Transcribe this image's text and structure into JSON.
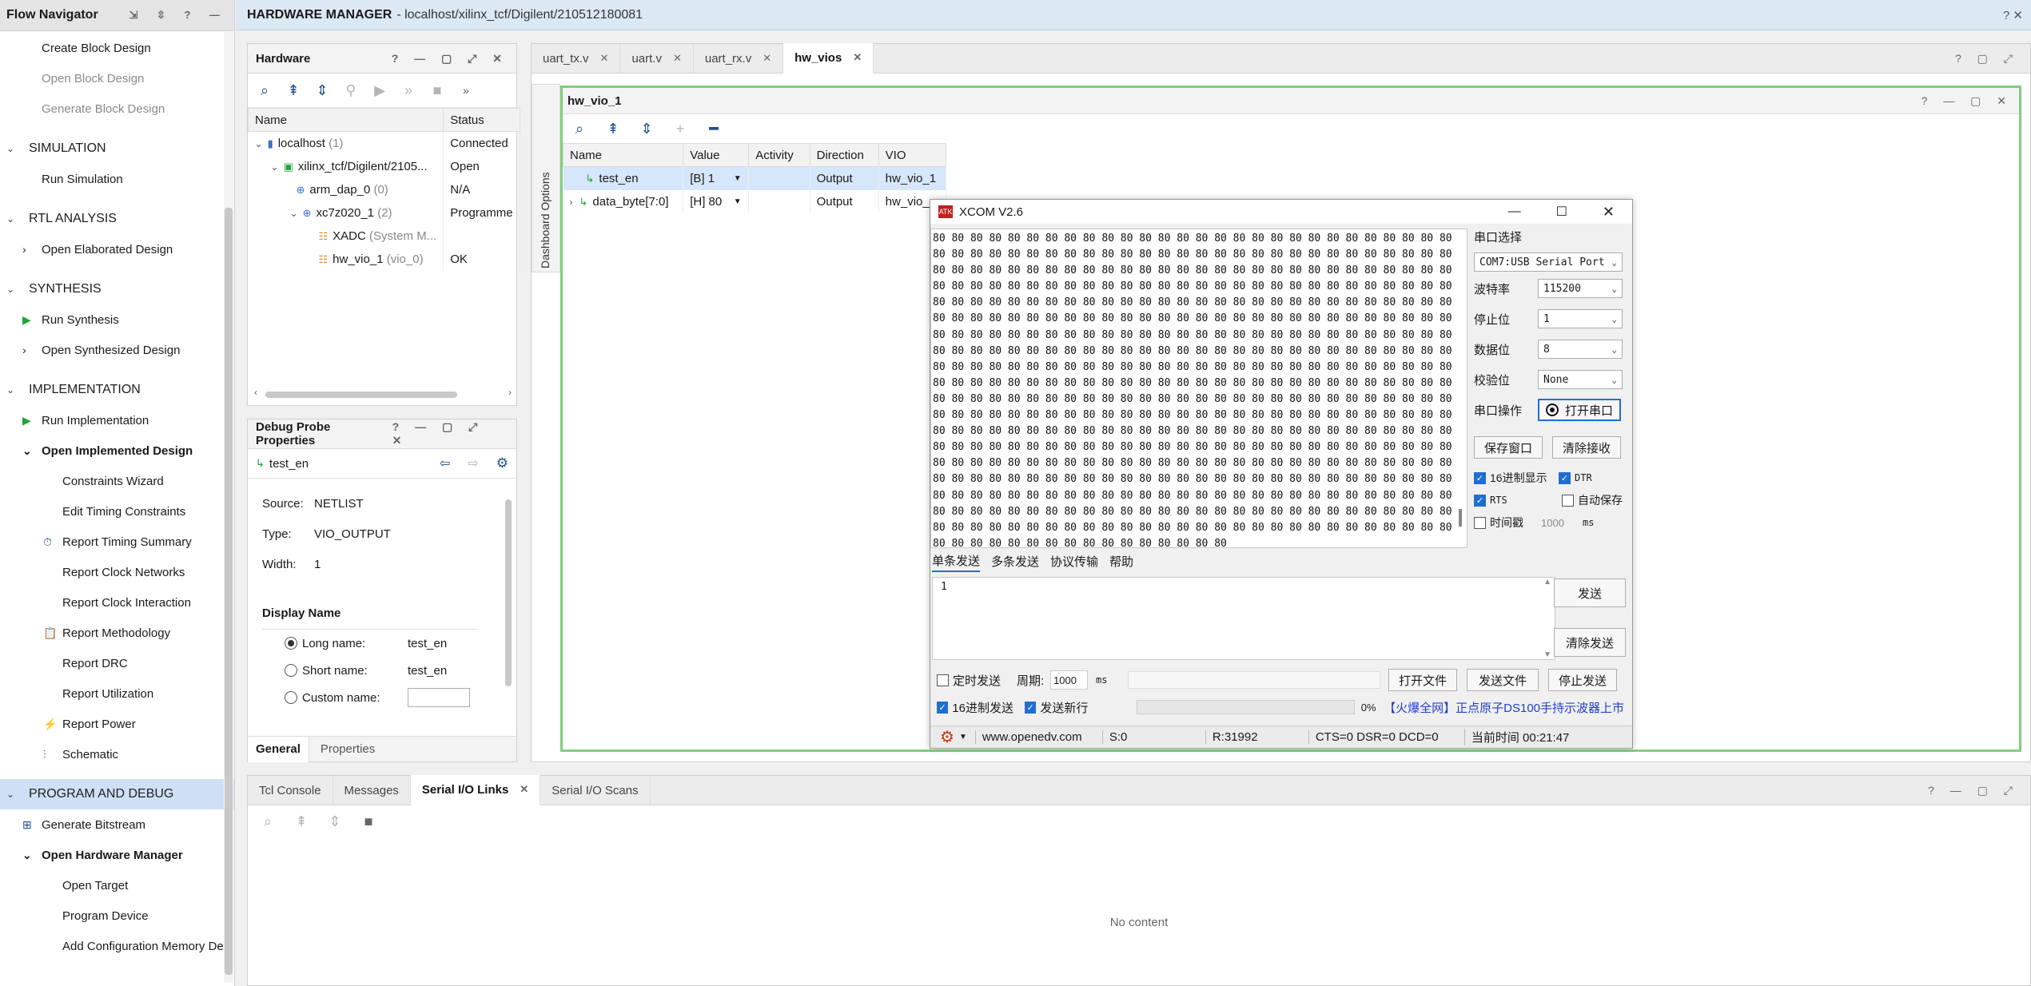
{
  "flow_navigator": {
    "title": "Flow Navigator",
    "items": [
      {
        "kind": "item",
        "label": "Create Block Design",
        "state": "normal"
      },
      {
        "kind": "item",
        "label": "Open Block Design",
        "state": "disabled"
      },
      {
        "kind": "item",
        "label": "Generate Block Design",
        "state": "disabled"
      },
      {
        "kind": "section",
        "label": "SIMULATION"
      },
      {
        "kind": "item",
        "label": "Run Simulation",
        "state": "normal"
      },
      {
        "kind": "section",
        "label": "RTL ANALYSIS"
      },
      {
        "kind": "item",
        "label": "Open Elaborated Design",
        "state": "normal"
      },
      {
        "kind": "section",
        "label": "SYNTHESIS"
      },
      {
        "kind": "item",
        "label": "Run Synthesis",
        "state": "normal"
      },
      {
        "kind": "item",
        "label": "Open Synthesized Design",
        "state": "normal"
      },
      {
        "kind": "section",
        "label": "IMPLEMENTATION"
      },
      {
        "kind": "item",
        "label": "Run Implementation",
        "state": "normal"
      },
      {
        "kind": "item",
        "label": "Open Implemented Design",
        "state": "bold"
      },
      {
        "kind": "sub",
        "label": "Constraints Wizard"
      },
      {
        "kind": "sub",
        "label": "Edit Timing Constraints"
      },
      {
        "kind": "sub",
        "label": "Report Timing Summary"
      },
      {
        "kind": "sub",
        "label": "Report Clock Networks"
      },
      {
        "kind": "sub",
        "label": "Report Clock Interaction"
      },
      {
        "kind": "sub",
        "label": "Report Methodology"
      },
      {
        "kind": "sub",
        "label": "Report DRC"
      },
      {
        "kind": "sub",
        "label": "Report Utilization"
      },
      {
        "kind": "sub",
        "label": "Report Power"
      },
      {
        "kind": "sub",
        "label": "Schematic"
      },
      {
        "kind": "section",
        "label": "PROGRAM AND DEBUG"
      },
      {
        "kind": "item",
        "label": "Generate Bitstream",
        "state": "normal"
      },
      {
        "kind": "item",
        "label": "Open Hardware Manager",
        "state": "bold"
      },
      {
        "kind": "sub",
        "label": "Open Target"
      },
      {
        "kind": "sub",
        "label": "Program Device"
      },
      {
        "kind": "sub",
        "label": "Add Configuration Memory Dev"
      }
    ]
  },
  "header": {
    "title": "HARDWARE MANAGER",
    "path": "- localhost/xilinx_tcf/Digilent/210512180081"
  },
  "hardware_panel": {
    "title": "Hardware",
    "col_name": "Name",
    "col_status": "Status",
    "rows": [
      {
        "name": "localhost",
        "extra": "(1)",
        "status": "Connected"
      },
      {
        "name": "xilinx_tcf/Digilent/2105...",
        "extra": "",
        "status": "Open"
      },
      {
        "name": "arm_dap_0",
        "extra": "(0)",
        "status": "N/A"
      },
      {
        "name": "xc7z020_1",
        "extra": "(2)",
        "status": "Programme"
      },
      {
        "name": "XADC",
        "extra": "(System M...",
        "status": ""
      },
      {
        "name": "hw_vio_1",
        "extra": "(vio_0)",
        "status": "OK"
      }
    ]
  },
  "probe_panel": {
    "title": "Debug Probe Properties",
    "probe": "test_en",
    "source_label": "Source:",
    "source": "NETLIST",
    "type_label": "Type:",
    "type": "VIO_OUTPUT",
    "width_label": "Width:",
    "width": "1",
    "display_name": "Display Name",
    "long_label": "Long name:",
    "long_value": "test_en",
    "short_label": "Short name:",
    "short_value": "test_en",
    "custom_label": "Custom name:",
    "tab_general": "General",
    "tab_properties": "Properties"
  },
  "editor_tabs": [
    "uart_tx.v",
    "uart.v",
    "uart_rx.v",
    "hw_vios"
  ],
  "vio_panel": {
    "title": "hw_vio_1",
    "dashboard_options": "Dashboard Options",
    "cols": [
      "Name",
      "Value",
      "Activity",
      "Direction",
      "VIO"
    ],
    "rows": [
      {
        "name": "test_en",
        "value": "[B] 1",
        "activity": "",
        "direction": "Output",
        "vio": "hw_vio_1"
      },
      {
        "name": "data_byte[7:0]",
        "value": "[H] 80",
        "activity": "",
        "direction": "Output",
        "vio": "hw_vio_"
      }
    ]
  },
  "xcom": {
    "title": "XCOM V2.6",
    "rx_line": "80 80 80 80 80 80 80 80 80 80 80 80 80 80 80 80 80 80 80 80 80 80 80 80 80 80 80 80",
    "rx_last": "80 80 80 80 80 80 80 80 80 80 80 80 80 80 80 80",
    "rx_line_count": 19,
    "port_select": "串口选择",
    "port_value": "COM7:USB Serial Port",
    "baud_label": "波特率",
    "baud_value": "115200",
    "stop_label": "停止位",
    "stop_value": "1",
    "data_label": "数据位",
    "data_value": "8",
    "parity_label": "校验位",
    "parity_value": "None",
    "op_label": "串口操作",
    "open_port": "打开串口",
    "save_window": "保存窗口",
    "clear_rx": "清除接收",
    "hex_display": "16进制显示",
    "dtr": "DTR",
    "rts": "RTS",
    "auto_save": "自动保存",
    "timestamp": "时间戳",
    "timestamp_val": "1000",
    "ms": "ms",
    "tabs": [
      "单条发送",
      "多条发送",
      "协议传输",
      "帮助"
    ],
    "tx_text": "1",
    "send": "发送",
    "clear_send": "清除发送",
    "timed_send": "定时发送",
    "period_label": "周期:",
    "period_value": "1000",
    "open_file": "打开文件",
    "send_file": "发送文件",
    "stop_send": "停止发送",
    "hex_send": "16进制发送",
    "send_newline": "发送新行",
    "progress": "0%",
    "ad": "【火爆全网】正点原子DS100手持示波器上市",
    "status_url": "www.openedv.com",
    "status_s": "S:0",
    "status_r": "R:31992",
    "status_lines": "CTS=0 DSR=0 DCD=0",
    "status_time": "当前时间 00:21:47"
  },
  "bottom_panel": {
    "tabs": [
      "Tcl Console",
      "Messages",
      "Serial I/O Links",
      "Serial I/O Scans"
    ],
    "active": "Serial I/O Links",
    "empty": "No content"
  }
}
